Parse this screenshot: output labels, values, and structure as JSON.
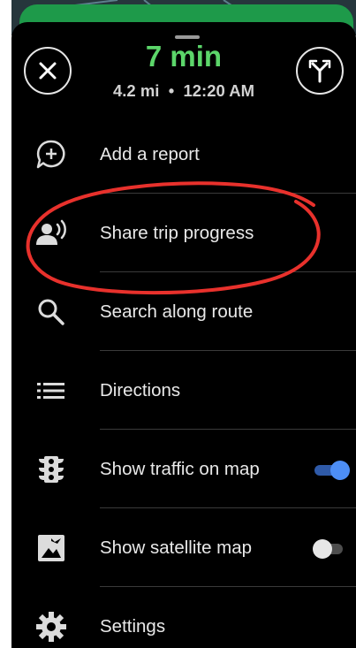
{
  "header": {
    "eta_time": "7 min",
    "distance": "4.2 mi",
    "separator": "•",
    "arrival_time": "12:20 AM"
  },
  "menu": {
    "add_report": "Add a report",
    "share_trip": "Share trip progress",
    "search_route": "Search along route",
    "directions": "Directions",
    "show_traffic": "Show traffic on map",
    "show_satellite": "Show satellite map",
    "settings": "Settings"
  },
  "toggles": {
    "traffic_on": true,
    "satellite_on": false
  },
  "colors": {
    "eta_green": "#5cd66a",
    "toggle_on": "#4d8ef5",
    "annotation_red": "#e8312c"
  }
}
